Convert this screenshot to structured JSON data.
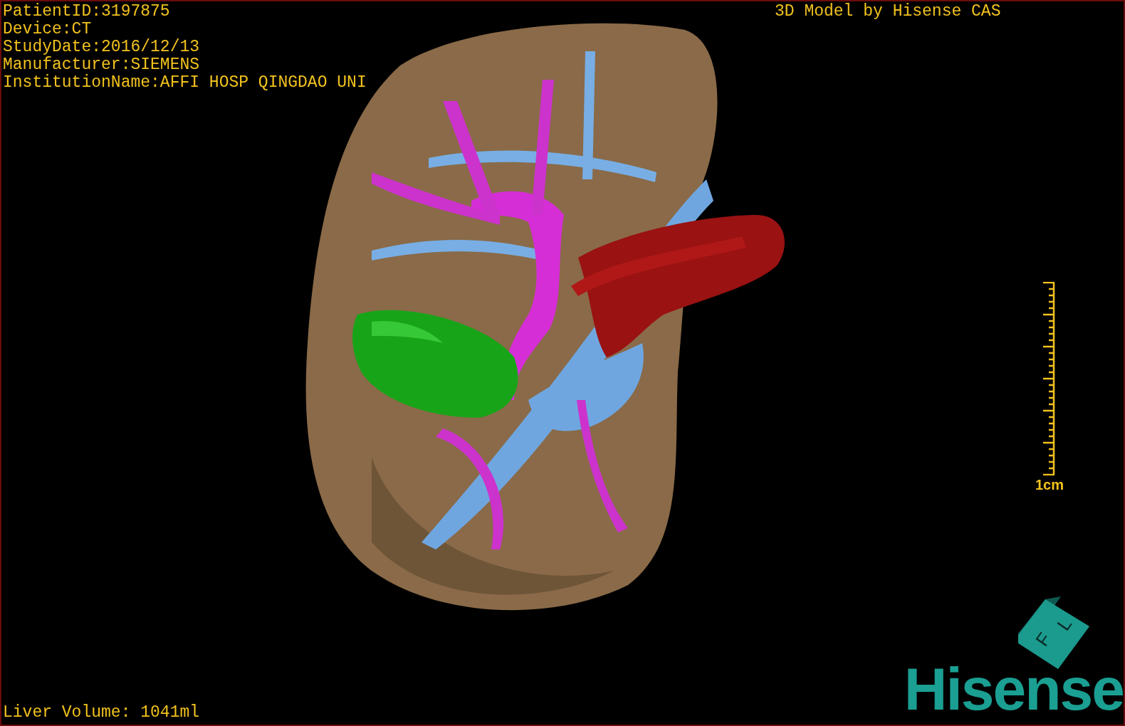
{
  "info_lines": [
    "PatientID:3197875",
    "Device:CT",
    "StudyDate:2016/12/13",
    "Manufacturer:SIEMENS",
    "InstitutionName:AFFI HOSP QINGDAO UNI"
  ],
  "title": "3D Model by Hisense CAS",
  "scale_label": "1cm",
  "orientation_cube": {
    "labels": [
      "F",
      "L"
    ]
  },
  "logo": "Hisense",
  "liver_volume": "Liver Volume: 1041ml"
}
